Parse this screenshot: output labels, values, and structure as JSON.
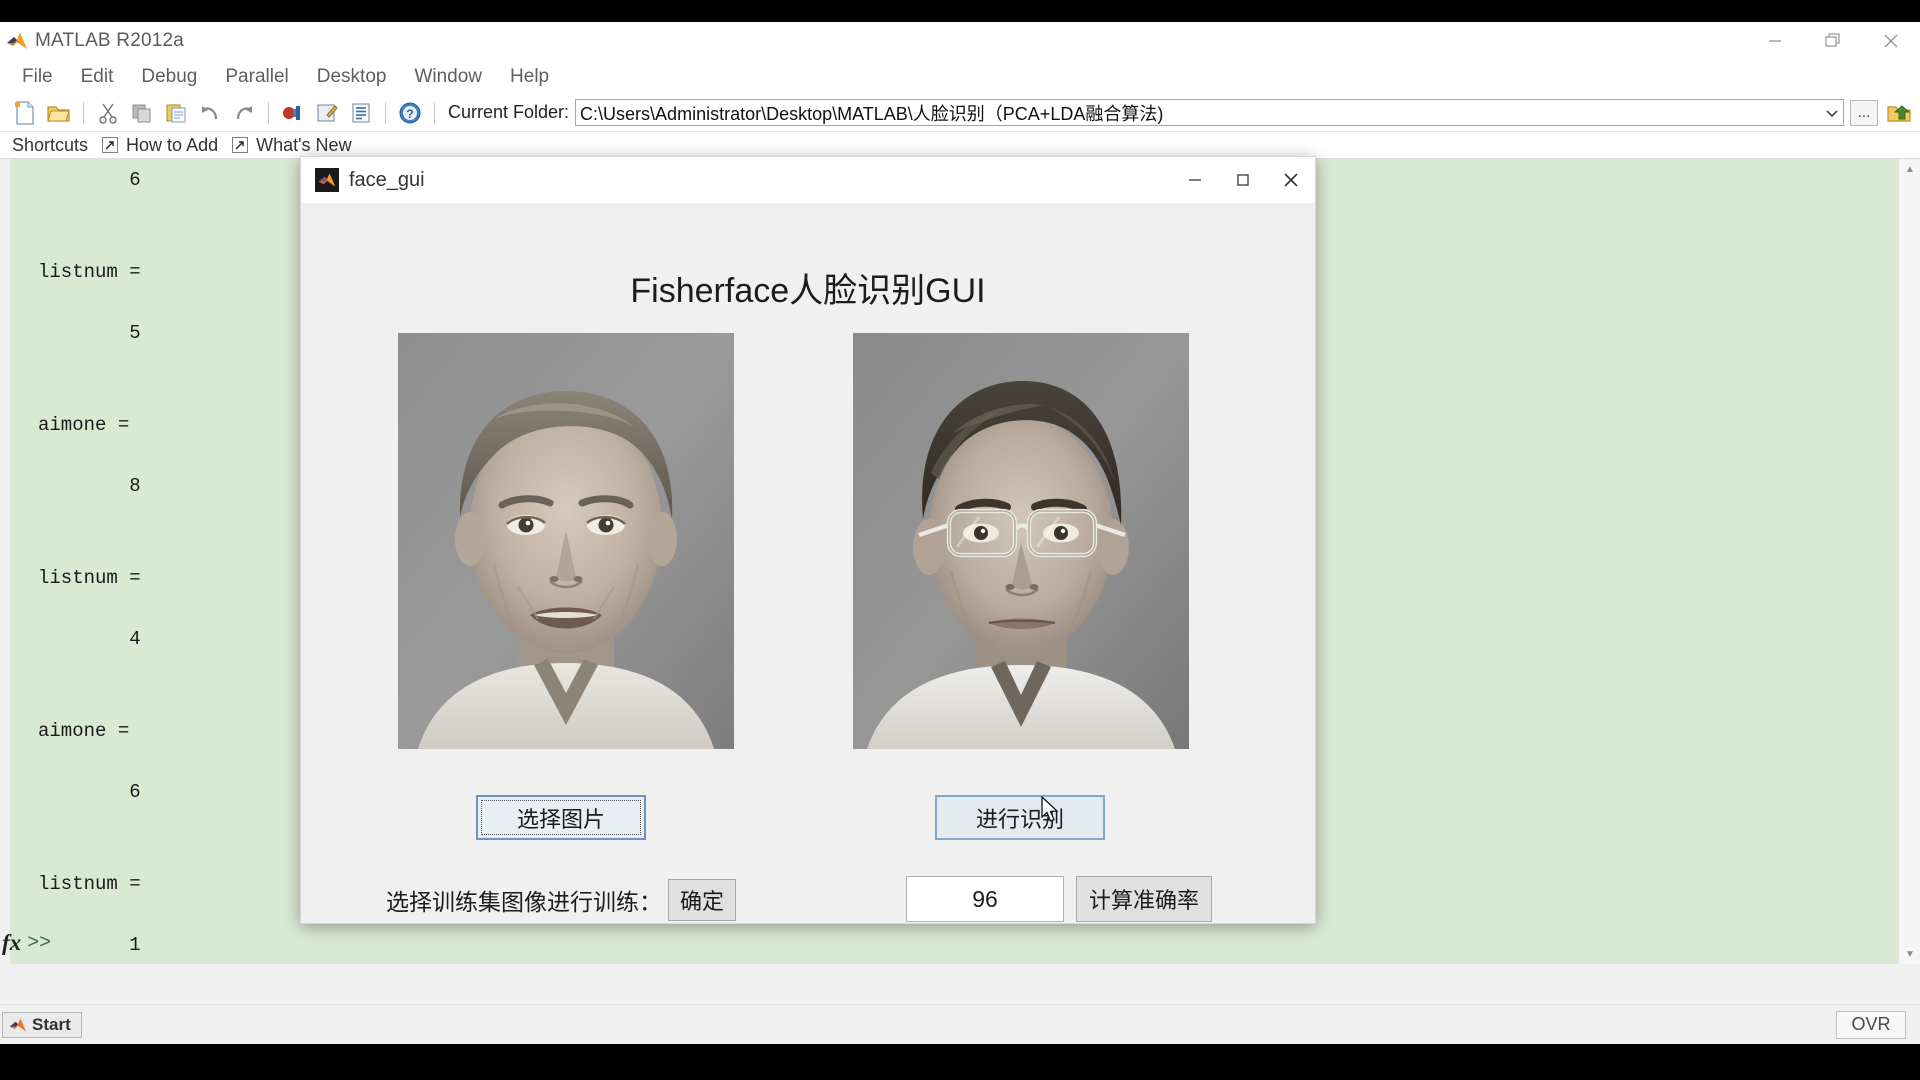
{
  "app": {
    "title": "MATLAB  R2012a",
    "logo_icon": "matlab-logo-icon",
    "window_controls": {
      "minimize": "minimize-icon",
      "restore": "restore-icon",
      "close": "close-icon"
    }
  },
  "menubar": {
    "items": [
      {
        "label": "File"
      },
      {
        "label": "Edit"
      },
      {
        "label": "Debug"
      },
      {
        "label": "Parallel"
      },
      {
        "label": "Desktop"
      },
      {
        "label": "Window"
      },
      {
        "label": "Help"
      }
    ]
  },
  "toolbar": {
    "icons": [
      "new-script-icon",
      "open-folder-icon",
      "cut-icon",
      "copy-icon",
      "paste-icon",
      "undo-icon",
      "redo-icon",
      "simulink-icon",
      "guide-icon",
      "profiler-icon",
      "help-icon"
    ],
    "current_folder_label": "Current Folder:",
    "current_folder_path": "C:\\Users\\Administrator\\Desktop\\MATLAB\\人脸识别（PCA+LDA融合算法)",
    "dropdown_icon": "chevron-down-icon",
    "browse_label": "...",
    "browse_icon": "browse-folder-icon",
    "up_one_level_icon": "up-folder-icon"
  },
  "shortcuts_bar": {
    "label": "Shortcuts",
    "items": [
      {
        "label": "How to Add",
        "icon": "shortcut-arrow-icon"
      },
      {
        "label": "What's New",
        "icon": "shortcut-arrow-icon"
      }
    ]
  },
  "command_window": {
    "output": "        6\n\n\nlistnum =\n\n        5\n\n\naimone =\n\n        8\n\n\nlistnum =\n\n        4\n\n\naimone =\n\n        6\n\n\nlistnum =\n\n        1\n",
    "prompt": ">>",
    "fx_label": "fx",
    "background_color": "#d9ead3"
  },
  "statusbar": {
    "start_label": "Start",
    "start_icon": "matlab-logo-icon",
    "overwrite_mode": "OVR"
  },
  "face_gui": {
    "title": "face_gui",
    "icon": "matlab-logo-icon",
    "window_controls": {
      "minimize": "minimize-icon",
      "maximize": "maximize-icon",
      "close": "close-icon"
    },
    "heading": "Fisherface人脸识别GUI",
    "left_image": {
      "name": "query-face-image",
      "alt": "grayscale portrait of a man without glasses"
    },
    "right_image": {
      "name": "matched-face-image",
      "alt": "grayscale portrait of a man with eyeglasses"
    },
    "select_button_label": "选择图片",
    "recognize_button_label": "进行识别",
    "train_label": "选择训练集图像进行训练：",
    "confirm_button_label": "确定",
    "accuracy_value": "96",
    "accuracy_button_label": "计算准确率",
    "cursor_icon": "mouse-pointer-icon"
  },
  "colors": {
    "command_bg": "#d9ead3",
    "window_bg": "#f0f0f0",
    "button_accent": "#6b93c4",
    "titlebar_bg": "#ffffff"
  }
}
